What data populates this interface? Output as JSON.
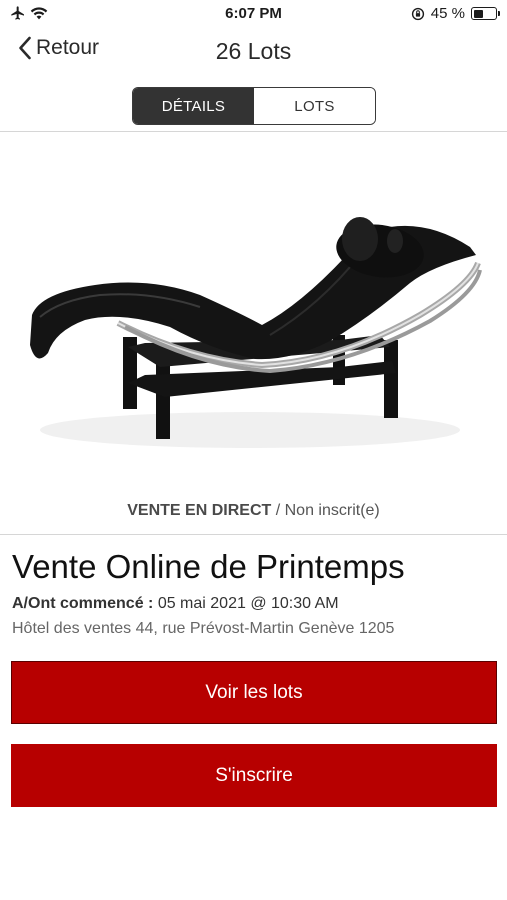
{
  "status_bar": {
    "time": "6:07 PM",
    "battery_percent": "45 %",
    "battery_level": 0.45
  },
  "nav": {
    "back_label": "Retour",
    "title": "26 Lots"
  },
  "tabs": [
    {
      "label": "DÉTAILS",
      "active": true
    },
    {
      "label": "LOTS",
      "active": false
    }
  ],
  "sale": {
    "status_label": "VENTE EN DIRECT",
    "status_separator": " / ",
    "registration_status": "Non inscrit(e)",
    "title": "Vente Online de Printemps",
    "date_label": "A/Ont commencé :",
    "date_value": "05 mai 2021 @ 10:30 AM",
    "address": "Hôtel des ventes 44, rue Prévost-Martin Genève 1205"
  },
  "buttons": {
    "view_lots": "Voir les lots",
    "register": "S'inscrire"
  },
  "colors": {
    "accent": "#b70000",
    "segment_active": "#333333"
  }
}
